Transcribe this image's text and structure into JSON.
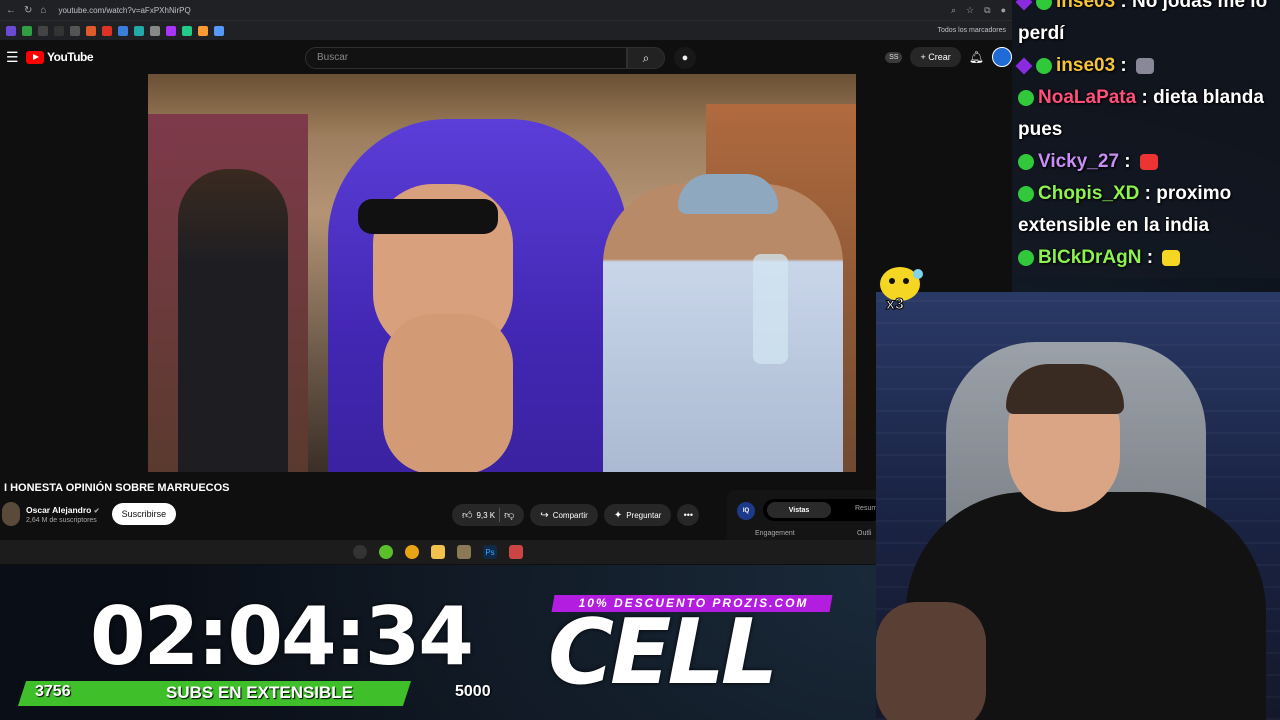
{
  "browser": {
    "url": "youtube.com/watch?v=aFxPXhNirPQ",
    "bookmarks_folder": "Todos los marcadores"
  },
  "youtube": {
    "logo_text": "YouTube",
    "search_placeholder": "Buscar",
    "badge_ss": "SS",
    "create_label": "Crear",
    "video_title": "I HONESTA OPINIÓN SOBRE MARRUECOS",
    "channel_name": "Oscar Alejandro",
    "channel_subs": "2,64 M de suscriptores",
    "subscribe_label": "Suscribirse",
    "like_count": "9,3 K",
    "share_label": "Compartir",
    "ask_label": "Preguntar",
    "more_label": "•••",
    "panel": {
      "iq": "IQ",
      "tab_active": "Vistas",
      "tab_other": "Resum",
      "engagement": "Engagement",
      "outline": "Outli"
    }
  },
  "chat": {
    "messages": [
      {
        "user": "inse03",
        "text": " : No jodas me lo perdí",
        "color": "#f6c43a",
        "badge": "prime"
      },
      {
        "user": "inse03",
        "text": " : ",
        "color": "#f6c43a",
        "badge": "prime",
        "emote": "cat"
      },
      {
        "user": "NoaLaPata",
        "text": " : dieta blanda pues",
        "color": "#ff4f7a",
        "badge": "sub"
      },
      {
        "user": "Vicky_27",
        "text": " : ",
        "color": "#c98ef5",
        "badge": "sub",
        "emote": "face"
      },
      {
        "user": "Chopis_XD",
        "text": " : proximo extensible en la india",
        "color": "#8cf24f",
        "badge": "sub"
      },
      {
        "user": "BlCkDrAgN",
        "text": " : ",
        "color": "#8cf24f",
        "badge": "sub",
        "emote": "pika"
      }
    ]
  },
  "overlay": {
    "timer": "02:04:34",
    "goal_current": "3756",
    "goal_label": "SUBS EN EXTENSIBLE",
    "goal_max": "5000",
    "goal_progress": 0.7512,
    "promo": "10% DESCUENTO PROZIS.COM",
    "brand": "CELL",
    "mascot_text": "x3"
  },
  "colors": {
    "yt_red": "#ff0000",
    "goal_green": "#3fbf2a",
    "promo_purple": "#b31de0"
  }
}
